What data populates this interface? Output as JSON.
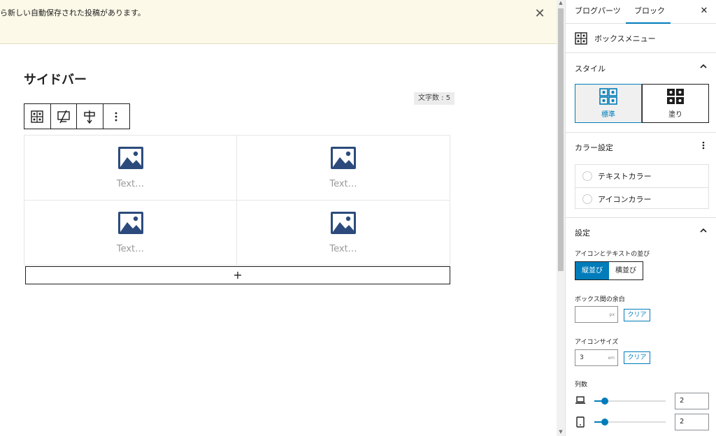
{
  "notice": {
    "text": "ら新しい自動保存された投稿があります。",
    "close_icon": "close-icon"
  },
  "editor": {
    "title": "サイドバー",
    "char_count": "文字数 : 5",
    "toolbar_icons": [
      "box-menu-icon",
      "transform-icon",
      "align-icon",
      "more-vertical-icon"
    ],
    "items": [
      {
        "text": "Text…",
        "icon": "image-icon"
      },
      {
        "text": "Text…",
        "icon": "image-icon"
      },
      {
        "text": "Text…",
        "icon": "image-icon"
      },
      {
        "text": "Text…",
        "icon": "image-icon"
      }
    ],
    "add_label": "+"
  },
  "sidebar": {
    "tabs": [
      "ブログパーツ",
      "ブロック"
    ],
    "active_tab": "ブロック",
    "close_label": "✕",
    "block_name": "ボックスメニュー",
    "style": {
      "heading": "スタイル",
      "options": [
        {
          "label": "標準",
          "active": true
        },
        {
          "label": "塗り",
          "active": false
        }
      ]
    },
    "color": {
      "heading": "カラー設定",
      "rows": [
        "テキストカラー",
        "アイコンカラー"
      ]
    },
    "settings": {
      "heading": "設定",
      "layout_label": "アイコンとテキストの並び",
      "layout_options": [
        "縦並び",
        "横並び"
      ],
      "layout_active": "縦並び",
      "gap_label": "ボックス間の余白",
      "gap_value": "",
      "gap_unit": "px",
      "clear_label": "クリア",
      "icon_size_label": "アイコンサイズ",
      "icon_size_value": "3",
      "icon_size_unit": "em",
      "columns_label": "列数",
      "columns": [
        {
          "device": "laptop-icon",
          "value": "2",
          "fraction": 0.15
        },
        {
          "device": "tablet-icon",
          "value": "2",
          "fraction": 0.15
        }
      ]
    }
  },
  "colors": {
    "accent": "#007cba",
    "image_icon": "#2c4b7c",
    "notice_bg": "#fcf9e8"
  }
}
